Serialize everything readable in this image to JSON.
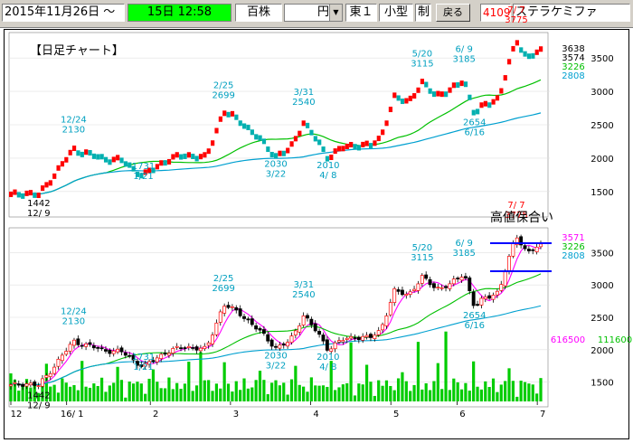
{
  "toolbar": {
    "date": "2015年11月26日 ～",
    "time_field": "15日 12:58",
    "unit": "百株",
    "currency": "円",
    "market": "東１",
    "size": "小型",
    "system": "制",
    "back_label": "戻る",
    "code": "4109",
    "name": "ステラケミファ"
  },
  "colors": {
    "up": "#ff0000",
    "down": "#00b0b0",
    "ma_short": "#ff00ff",
    "ma_mid": "#00c000",
    "ma_long": "#00a0d0",
    "volume": "#00cc00",
    "box_lines": "#0000ff",
    "label_peak": "#ff0000",
    "label_cyan": "#00a0c0"
  },
  "top_chart": {
    "title": "【日足チャート】",
    "legend_values": [
      {
        "text": "3638",
        "color": "#000000"
      },
      {
        "text": "3574",
        "color": "#000000"
      },
      {
        "text": "3226",
        "color": "#00c000"
      },
      {
        "text": "2808",
        "color": "#00a0d0"
      }
    ],
    "y_ticks": [
      "3500",
      "3000",
      "2500",
      "2000",
      "1500"
    ],
    "annotations": [
      {
        "lines": [
          "1442",
          "12/ 9"
        ],
        "color": "#000000"
      },
      {
        "lines": [
          "12/24",
          "2130"
        ],
        "color": "#00a0c0"
      },
      {
        "lines": [
          "1731",
          "1/21"
        ],
        "color": "#00a0c0"
      },
      {
        "lines": [
          "2/25",
          "2699"
        ],
        "color": "#00a0c0"
      },
      {
        "lines": [
          "2030",
          "3/22"
        ],
        "color": "#00a0c0"
      },
      {
        "lines": [
          "3/31",
          "2540"
        ],
        "color": "#00a0c0"
      },
      {
        "lines": [
          "2010",
          "4/ 8"
        ],
        "color": "#00a0c0"
      },
      {
        "lines": [
          "5/20",
          "3115"
        ],
        "color": "#00a0c0"
      },
      {
        "lines": [
          "6/ 9",
          "3185"
        ],
        "color": "#00a0c0"
      },
      {
        "lines": [
          "2654",
          "6/16"
        ],
        "color": "#00a0c0"
      },
      {
        "lines": [
          "7/ 7",
          "3775"
        ],
        "color": "#ff0000"
      }
    ]
  },
  "bottom_chart": {
    "box_label": "高値保合い",
    "legend_values": [
      {
        "text": "3571",
        "color": "#ff00ff"
      },
      {
        "text": "3226",
        "color": "#00c000"
      },
      {
        "text": "2808",
        "color": "#00a0d0"
      }
    ],
    "volume_legend": [
      {
        "text": "616500",
        "color": "#ff00ff"
      },
      {
        "text": "111600",
        "color": "#00c000"
      }
    ],
    "y_ticks": [
      "3500",
      "3000",
      "2500",
      "2000",
      "1500"
    ],
    "x_ticks": [
      "12",
      "16/ 1",
      "2",
      "3",
      "4",
      "5",
      "6",
      "7"
    ],
    "annotations": [
      {
        "lines": [
          "1442",
          "12/ 9"
        ],
        "color": "#000000"
      },
      {
        "lines": [
          "12/24",
          "2130"
        ],
        "color": "#00a0c0"
      },
      {
        "lines": [
          "1731",
          "1/21"
        ],
        "color": "#00a0c0"
      },
      {
        "lines": [
          "2/25",
          "2699"
        ],
        "color": "#00a0c0"
      },
      {
        "lines": [
          "2030",
          "3/22"
        ],
        "color": "#00a0c0"
      },
      {
        "lines": [
          "3/31",
          "2540"
        ],
        "color": "#00a0c0"
      },
      {
        "lines": [
          "2010",
          "4/ 8"
        ],
        "color": "#00a0c0"
      },
      {
        "lines": [
          "5/20",
          "3115"
        ],
        "color": "#00a0c0"
      },
      {
        "lines": [
          "6/ 9",
          "3185"
        ],
        "color": "#00a0c0"
      },
      {
        "lines": [
          "2654",
          "6/16"
        ],
        "color": "#00a0c0"
      },
      {
        "lines": [
          "7/ 7",
          "3775"
        ],
        "color": "#ff0000"
      }
    ]
  },
  "chart_data": [
    {
      "type": "line",
      "title": "【日足チャート】",
      "x": [
        "12/9",
        "12/24",
        "1/21",
        "2/25",
        "3/22",
        "3/31",
        "4/8",
        "5/20",
        "6/9",
        "6/16",
        "7/7"
      ],
      "series": [
        {
          "name": "",
          "values": [
            1442,
            2130,
            1731,
            2699,
            2030,
            2540,
            2010,
            3115,
            3185,
            2654,
            3775
          ]
        }
      ],
      "ylim": [
        1200,
        3800
      ],
      "y_ticks": [
        1500,
        2000,
        2500,
        3000,
        3500
      ]
    },
    {
      "type": "line",
      "x_ticks": [
        "12",
        "16/ 1",
        "2",
        "3",
        "4",
        "5",
        "6",
        "7"
      ],
      "x": [
        "12/9",
        "12/24",
        "1/21",
        "2/25",
        "3/22",
        "3/31",
        "4/8",
        "5/20",
        "6/9",
        "6/16",
        "7/7"
      ],
      "series": [
        {
          "name": "",
          "values": [
            1442,
            2130,
            1731,
            2699,
            2030,
            2540,
            2010,
            3115,
            3185,
            2654,
            3775
          ]
        }
      ],
      "ylim": [
        1200,
        3800
      ],
      "y_ticks": [
        1500,
        2000,
        2500,
        3000,
        3500
      ],
      "box_range": [
        3300,
        3700
      ]
    }
  ]
}
